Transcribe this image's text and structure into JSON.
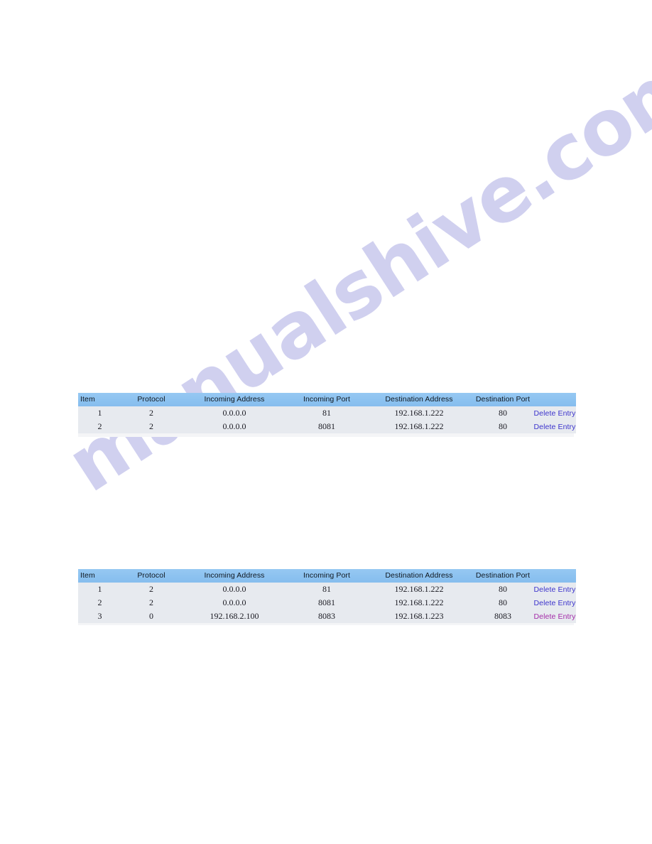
{
  "watermark": {
    "text": "manualshive.com"
  },
  "tables": [
    {
      "id": "table-1",
      "name": "port-forwarding-table-1",
      "columns": [
        "Item",
        "Protocol",
        "Incoming Address",
        "Incoming Port",
        "Destination Address",
        "Destination Port",
        ""
      ],
      "rows": [
        {
          "item": "1",
          "protocol": "2",
          "incoming_address": "0.0.0.0",
          "incoming_port": "81",
          "destination_address": "192.168.1.222",
          "destination_port": "80",
          "action": "Delete Entry",
          "action_state": "link"
        },
        {
          "item": "2",
          "protocol": "2",
          "incoming_address": "0.0.0.0",
          "incoming_port": "8081",
          "destination_address": "192.168.1.222",
          "destination_port": "80",
          "action": "Delete Entry",
          "action_state": "link"
        }
      ]
    },
    {
      "id": "table-2",
      "name": "port-forwarding-table-2",
      "columns": [
        "Item",
        "Protocol",
        "Incoming Address",
        "Incoming Port",
        "Destination Address",
        "Destination Port",
        ""
      ],
      "rows": [
        {
          "item": "1",
          "protocol": "2",
          "incoming_address": "0.0.0.0",
          "incoming_port": "81",
          "destination_address": "192.168.1.222",
          "destination_port": "80",
          "action": "Delete Entry",
          "action_state": "link"
        },
        {
          "item": "2",
          "protocol": "2",
          "incoming_address": "0.0.0.0",
          "incoming_port": "8081",
          "destination_address": "192.168.1.222",
          "destination_port": "80",
          "action": "Delete Entry",
          "action_state": "link"
        },
        {
          "item": "3",
          "protocol": "0",
          "incoming_address": "192.168.2.100",
          "incoming_port": "8083",
          "destination_address": "192.168.1.223",
          "destination_port": "8083",
          "action": "Delete Entry",
          "action_state": "visited"
        }
      ]
    }
  ],
  "colors": {
    "header_blue": "#8cc2f0",
    "row_background": "#e7eaef",
    "link_blue": "#3c33cc",
    "link_visited": "#a32aa8",
    "watermark_lavender": "#ceceef",
    "page_background": "#ffffff"
  }
}
